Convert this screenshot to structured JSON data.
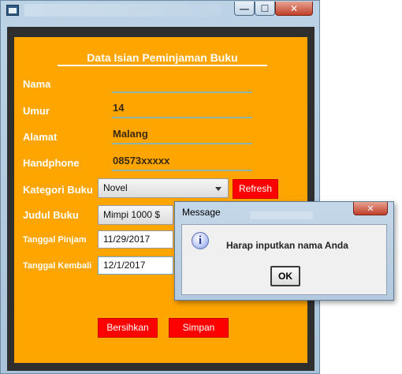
{
  "window": {
    "controls": {
      "minimize": "—",
      "maximize": "☐",
      "close": "✕"
    }
  },
  "form": {
    "heading": "Data Isian Peminjaman Buku",
    "labels": {
      "nama": "Nama",
      "umur": "Umur",
      "alamat": "Alamat",
      "handphone": "Handphone",
      "kategori": "Kategori Buku",
      "judul": "Judul Buku",
      "tanggal_pinjam": "Tanggal Pinjam",
      "tanggal_kembali": "Tanggal Kembali"
    },
    "values": {
      "nama": "",
      "umur": "14",
      "alamat": "Malang",
      "handphone": "08573xxxxx",
      "kategori": "Novel",
      "judul": "Mimpi 1000 $",
      "tanggal_pinjam": "11/29/2017",
      "tanggal_kembali": "12/1/2017"
    },
    "buttons": {
      "refresh": "Refresh",
      "clear": "Bersihkan",
      "save": "Simpan"
    },
    "colors": {
      "panel": "#ffa500",
      "button": "#ff0000"
    }
  },
  "dialog": {
    "title": "Message",
    "close": "✕",
    "icon": "info-icon",
    "icon_glyph": "i",
    "message": "Harap inputkan nama Anda",
    "ok": "OK"
  }
}
